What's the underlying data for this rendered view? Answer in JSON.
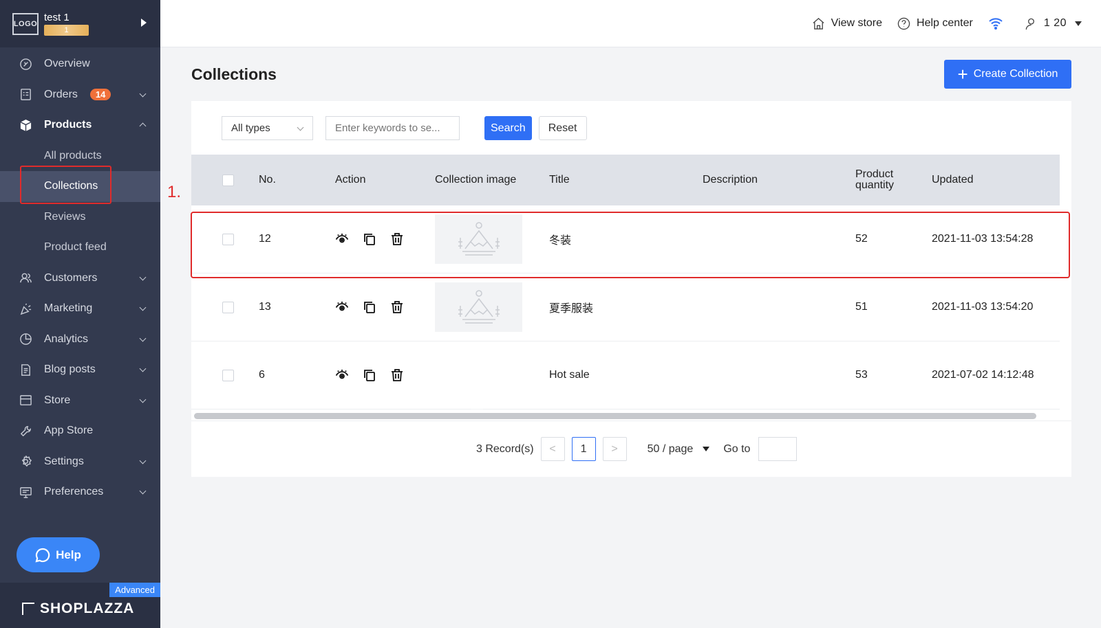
{
  "store": {
    "logo_text": "LOGO",
    "name": "test 1",
    "tag": "1"
  },
  "nav": {
    "items": [
      {
        "label": "Overview",
        "icon": "overview-icon"
      },
      {
        "label": "Orders",
        "icon": "orders-icon",
        "badge": "14"
      },
      {
        "label": "Products",
        "icon": "products-icon"
      },
      {
        "label": "Customers",
        "icon": "customers-icon"
      },
      {
        "label": "Marketing",
        "icon": "marketing-icon"
      },
      {
        "label": "Analytics",
        "icon": "analytics-icon"
      },
      {
        "label": "Blog posts",
        "icon": "blog-icon"
      },
      {
        "label": "Store",
        "icon": "store-icon"
      },
      {
        "label": "App Store",
        "icon": "app-store-icon"
      },
      {
        "label": "Settings",
        "icon": "settings-icon"
      },
      {
        "label": "Preferences",
        "icon": "preferences-icon"
      }
    ],
    "product_sub": [
      "All products",
      "Collections",
      "Reviews",
      "Product feed"
    ]
  },
  "annotation": {
    "step": "1."
  },
  "help_label": "Help",
  "footer": {
    "plan": "Advanced",
    "brand": "SHOPLAZZA"
  },
  "header": {
    "view_store": "View store",
    "help_center": "Help center",
    "user_id": "1 20"
  },
  "page": {
    "title": "Collections",
    "create_label": "Create Collection"
  },
  "filters": {
    "type_value": "All types",
    "search_placeholder": "Enter keywords to se...",
    "search_label": "Search",
    "reset_label": "Reset"
  },
  "table": {
    "headers": {
      "no": "No.",
      "action": "Action",
      "image": "Collection image",
      "title": "Title",
      "description": "Description",
      "qty_line1": "Product",
      "qty_line2": "quantity",
      "updated": "Updated"
    },
    "rows": [
      {
        "no": "12",
        "title": "冬装",
        "description": "",
        "qty": "52",
        "updated": "2021-11-03 13:54:28",
        "image": "placeholder"
      },
      {
        "no": "13",
        "title": "夏季服装",
        "description": "",
        "qty": "51",
        "updated": "2021-11-03 13:54:20",
        "image": "placeholder"
      },
      {
        "no": "6",
        "title": "Hot sale",
        "description": "",
        "qty": "53",
        "updated": "2021-07-02 14:12:48",
        "image": "photo"
      }
    ]
  },
  "pagination": {
    "records": "3 Record(s)",
    "prev": "<",
    "current": "1",
    "next": ">",
    "per_page": "50 / page",
    "goto_label": "Go to"
  },
  "colors": {
    "primary": "#2f6ff5",
    "sidebar": "#333a4f",
    "highlight": "#e02b2b",
    "badge": "#f0703a"
  }
}
